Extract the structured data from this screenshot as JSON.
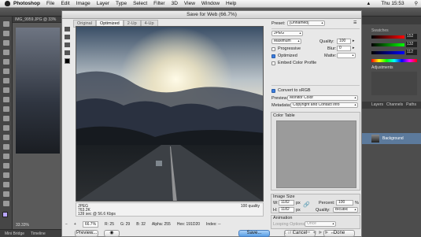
{
  "menubar": {
    "app": "Photoshop",
    "items": [
      "File",
      "Edit",
      "Image",
      "Layer",
      "Type",
      "Select",
      "Filter",
      "3D",
      "View",
      "Window",
      "Help"
    ],
    "clock": "Thu 15:53"
  },
  "document_tab": "IMG_9959.JPG @ 33%",
  "zoom_indicator": "33.33%",
  "bottom_tabs": [
    "Mini Bridge",
    "Timeline"
  ],
  "right_panel": {
    "swatches_title": "Swatches",
    "adjustments_title": "Adjustments",
    "layers_tabs": [
      "Layers",
      "Channels",
      "Paths"
    ],
    "layer_name": "Background",
    "slider_values": [
      "152",
      "132",
      "112"
    ]
  },
  "dialog": {
    "title": "Save for Web (66.7%)",
    "tabs": [
      "Original",
      "Optimized",
      "2-Up",
      "4-Up"
    ],
    "active_tab": "Optimized",
    "preview_info": {
      "format": "JPEG",
      "size": "763.2K",
      "time": "139 sec @ 56.6 Kbps",
      "quality": "100 quality"
    },
    "status": {
      "zoom": "66.7%",
      "r": "R: 25",
      "g": "G: 29",
      "b": "B: 32",
      "alpha": "Alpha: 255",
      "hex": "Hex: 191D20",
      "index": "Index: --"
    },
    "settings": {
      "preset_label": "Preset:",
      "preset_value": "[Unnamed]",
      "format_value": "JPEG",
      "compression_value": "Maximum",
      "quality_label": "Quality:",
      "quality_value": "100",
      "progressive_label": "Progressive",
      "blur_label": "Blur:",
      "blur_value": "0",
      "optimized_label": "Optimized",
      "matte_label": "Matte:",
      "embed_label": "Embed Color Profile",
      "srgb_label": "Convert to sRGB",
      "preview_label": "Preview:",
      "preview_value": "Monitor Color",
      "metadata_label": "Metadata:",
      "metadata_value": "Copyright and Contact Info",
      "color_table_label": "Color Table",
      "image_size_label": "Image Size",
      "w_label": "W:",
      "w_value": "1182",
      "h_label": "H:",
      "h_value": "1182",
      "px": "px",
      "percent_label": "Percent:",
      "percent_value": "100",
      "percent_unit": "%",
      "resample_quality_label": "Quality:",
      "resample_value": "Bicubic",
      "animation_label": "Animation",
      "looping_label": "Looping Options:",
      "looping_value": "Once",
      "frame_counter": "1 of 1"
    },
    "buttons": {
      "preview": "Preview...",
      "save": "Save...",
      "cancel": "Cancel",
      "done": "Done"
    }
  }
}
